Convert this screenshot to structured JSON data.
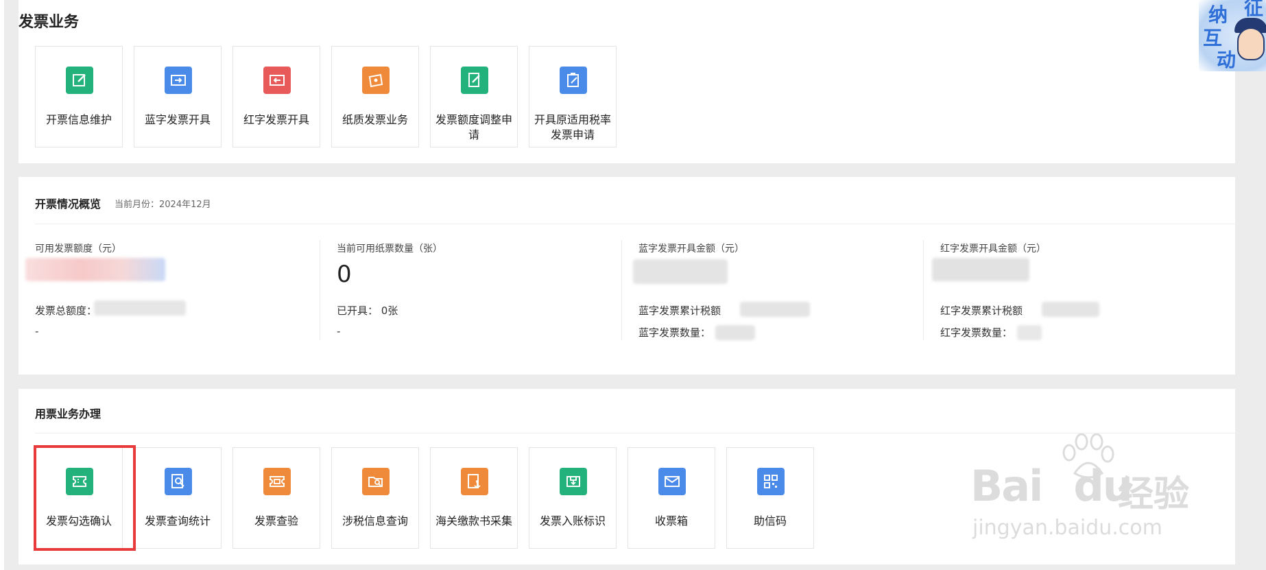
{
  "page": {
    "title": "发票业务"
  },
  "invoice_business": {
    "tiles": [
      {
        "label": "开票信息维护",
        "color": "#23b27c",
        "icon": "edit-form-icon"
      },
      {
        "label": "蓝字发票开具",
        "color": "#4a8bea",
        "icon": "ticket-arrow-right-icon"
      },
      {
        "label": "红字发票开具",
        "color": "#e85a5a",
        "icon": "ticket-arrow-left-icon"
      },
      {
        "label": "纸质发票业务",
        "color": "#f08a3b",
        "icon": "paper-ticket-icon"
      },
      {
        "label": "发票额度调整申请",
        "color": "#23b27c",
        "icon": "document-edit-icon"
      },
      {
        "label": "开具原适用税率发票申请",
        "color": "#4a8bea",
        "icon": "clipboard-edit-icon"
      }
    ]
  },
  "overview": {
    "title": "开票情况概览",
    "current_month_label": "当前月份：2024年12月",
    "stats": [
      {
        "caption": "可用发票额度（元）",
        "value": "",
        "row1": "发票总额度：",
        "row2": "-"
      },
      {
        "caption": "当前可用纸票数量（张）",
        "value": "0",
        "row1": "已开具： 0张",
        "row2": "-"
      },
      {
        "caption": "蓝字发票开具金额（元）",
        "value": "",
        "row1": "蓝字发票累计税额",
        "row2": "蓝字发票数量："
      },
      {
        "caption": "红字发票开具金额（元）",
        "value": "",
        "row1": "红字发票累计税额",
        "row2": "红字发票数量："
      }
    ]
  },
  "ticket_usage": {
    "title": "用票业务办理",
    "tiles": [
      {
        "label": "发票勾选确认",
        "color": "#23b27c",
        "icon": "ticket-icon"
      },
      {
        "label": "发票查询统计",
        "color": "#4a8bea",
        "icon": "search-document-icon"
      },
      {
        "label": "发票查验",
        "color": "#f08a3b",
        "icon": "ticket-check-icon"
      },
      {
        "label": "涉税信息查询",
        "color": "#f08a3b",
        "icon": "folder-search-icon"
      },
      {
        "label": "海关缴款书采集",
        "color": "#f08a3b",
        "icon": "anchor-document-icon"
      },
      {
        "label": "发票入账标识",
        "color": "#23b27c",
        "icon": "inbox-tag-icon"
      },
      {
        "label": "收票箱",
        "color": "#4a8bea",
        "icon": "mail-icon"
      },
      {
        "label": "助信码",
        "color": "#4a8bea",
        "icon": "qr-code-icon"
      }
    ]
  },
  "badge": {
    "chars": [
      "征",
      "纳",
      "互",
      "动"
    ]
  },
  "watermark": {
    "brand": "Bai",
    "brand2": "du",
    "cn": "经验",
    "url": "jingyan.baidu.com"
  }
}
